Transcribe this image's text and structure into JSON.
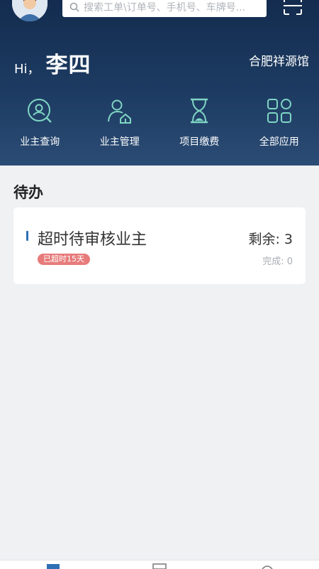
{
  "header": {
    "search_placeholder": "搜索工单\\订单号、手机号、车牌号...",
    "greeting": "Hi，",
    "user_name": "李四",
    "company": "合肥祥源馆"
  },
  "quick_actions": [
    {
      "label": "业主查询",
      "icon": "owner-search-icon"
    },
    {
      "label": "业主管理",
      "icon": "owner-manage-icon"
    },
    {
      "label": "项目缴费",
      "icon": "hourglass-icon"
    },
    {
      "label": "全部应用",
      "icon": "all-apps-icon"
    }
  ],
  "todo": {
    "section_title": "待办",
    "card": {
      "title": "超时待审核业主",
      "badge": "已超时15天",
      "remaining": "剩余: 3",
      "completed": "完成: 0"
    }
  },
  "colors": {
    "header_dark": "#132c4f",
    "icon_teal": "#7fd6c4",
    "badge_red": "#e77b7b",
    "accent_blue": "#2f6fb5"
  }
}
